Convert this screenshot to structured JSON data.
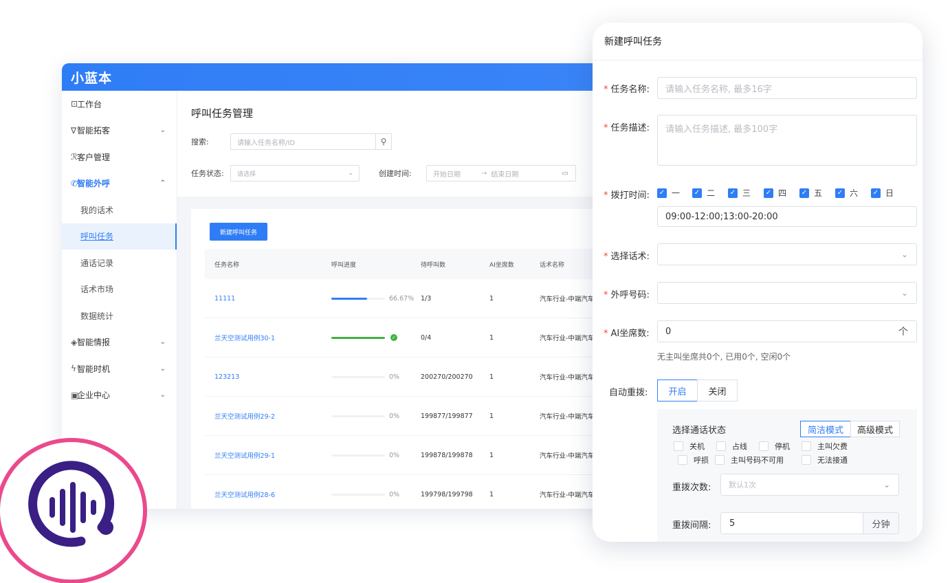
{
  "app": {
    "logo": "小蓝本",
    "sidebar": [
      {
        "label": "工作台",
        "icon": "chart-icon",
        "glyph": "⊡",
        "type": "group"
      },
      {
        "label": "智能拓客",
        "icon": "filter-icon",
        "glyph": "∇",
        "type": "group",
        "chevron": "⌄"
      },
      {
        "label": "客户管理",
        "icon": "users-icon",
        "glyph": "ℛ",
        "type": "group"
      },
      {
        "label": "智能外呼",
        "icon": "phone-icon",
        "glyph": "✆",
        "type": "active-group",
        "chevron": "⌃"
      },
      {
        "label": "我的话术",
        "type": "sub"
      },
      {
        "label": "呼叫任务",
        "type": "sub-selected"
      },
      {
        "label": "通话记录",
        "type": "sub"
      },
      {
        "label": "话术市场",
        "type": "sub"
      },
      {
        "label": "数据统计",
        "type": "sub"
      },
      {
        "label": "智能情报",
        "icon": "intel-icon",
        "glyph": "◈",
        "type": "group",
        "chevron": "⌄"
      },
      {
        "label": "智能时机",
        "icon": "bolt-icon",
        "glyph": "ϟ",
        "type": "group",
        "chevron": "⌄"
      },
      {
        "label": "企业中心",
        "icon": "building-icon",
        "glyph": "▣",
        "type": "group",
        "chevron": "⌄"
      }
    ],
    "page_title": "呼叫任务管理",
    "search_label": "搜索:",
    "search_placeholder": "请输入任务名称/ID",
    "status_label": "任务状态:",
    "status_placeholder": "请选择",
    "created_label": "创建时间:",
    "start_date": "开始日期",
    "date_arrow": "→",
    "end_date": "结束日期",
    "new_task_button": "新建呼叫任务",
    "table": {
      "headers": [
        "任务名称",
        "呼叫进度",
        "待呼叫数",
        "AI坐席数",
        "话术名称"
      ],
      "rows": [
        {
          "name": "11111",
          "progress": 0.6667,
          "percent": "66.67%",
          "pending": "1/3",
          "ai": "1",
          "script": "汽车行业-中端汽车",
          "color": "#2f7df6"
        },
        {
          "name": "兰天空测试用例30-1",
          "progress": 1.0,
          "percent": "",
          "done": true,
          "pending": "0/4",
          "ai": "1",
          "script": "汽车行业-中端汽车",
          "color": "#3fb33f"
        },
        {
          "name": "123213",
          "progress": 0,
          "percent": "0%",
          "pending": "200270/200270",
          "ai": "1",
          "script": "汽车行业-中端汽车",
          "color": "#2f7df6"
        },
        {
          "name": "兰天空测试用例29-2",
          "progress": 0,
          "percent": "0%",
          "pending": "199877/199877",
          "ai": "1",
          "script": "汽车行业-中端汽车",
          "color": "#2f7df6"
        },
        {
          "name": "兰天空测试用例29-1",
          "progress": 0,
          "percent": "0%",
          "pending": "199878/199878",
          "ai": "1",
          "script": "汽车行业-中端汽车",
          "color": "#2f7df6"
        },
        {
          "name": "兰天空测试用例28-6",
          "progress": 0,
          "percent": "0%",
          "pending": "199798/199798",
          "ai": "1",
          "script": "汽车行业-中端汽车",
          "color": "#2f7df6"
        }
      ]
    }
  },
  "dialog": {
    "title": "新建呼叫任务",
    "required_mark": "*",
    "name_label": "任务名称:",
    "name_placeholder": "请输入任务名称, 最多16字",
    "desc_label": "任务描述:",
    "desc_placeholder": "请输入任务描述, 最多100字",
    "dial_time_label": "拨打时间:",
    "days": [
      "一",
      "二",
      "三",
      "四",
      "五",
      "六",
      "日"
    ],
    "time_range": "09:00-12:00;13:00-20:00",
    "script_label": "选择话术:",
    "number_label": "外呼号码:",
    "ai_seats_label": "AI坐席数:",
    "ai_seats_value": "0",
    "ai_seats_unit": "个",
    "seat_hint": "无主叫坐席共0个, 已用0个, 空闲0个",
    "redial_label": "自动重拨:",
    "redial_on": "开启",
    "redial_off": "关闭",
    "call_status_label": "选择通话状态",
    "mode_simple": "简洁模式",
    "mode_advanced": "高级模式",
    "statuses": [
      "关机",
      "占线",
      "停机",
      "主叫欠费",
      "呼损",
      "主叫号码不可用",
      "无法接通"
    ],
    "redial_count_label": "重拨次数:",
    "redial_count_placeholder": "默认1次",
    "redial_interval_label": "重拨间隔:",
    "redial_interval_value": "5",
    "redial_interval_unit": "分钟"
  },
  "colors": {
    "primary": "#2f7df6",
    "success": "#3fb33f",
    "logo_ring": "#ea4a8c",
    "logo_mark": "#3a1f85",
    "required": "#f5463b"
  }
}
